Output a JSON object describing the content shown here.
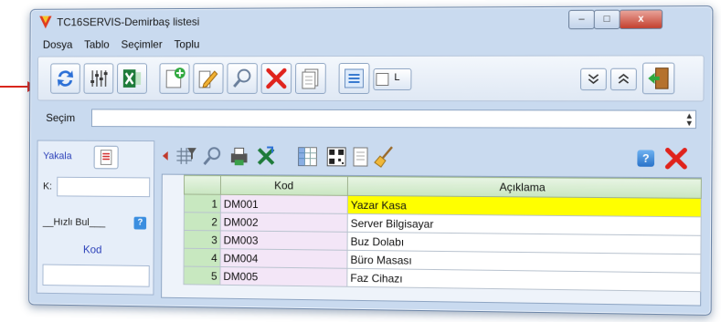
{
  "window": {
    "title": "TC16SERVIS-Demirbaş listesi",
    "controls": {
      "minimize": "–",
      "maximize": "□",
      "close": "x"
    }
  },
  "menu": [
    "Dosya",
    "Tablo",
    "Seçimler",
    "Toplu"
  ],
  "toolbar": {
    "buttons": [
      "refresh-icon",
      "equalizer-icon",
      "excel-icon",
      "add-doc-icon",
      "edit-icon",
      "search-icon",
      "delete-icon",
      "copy-icon",
      "zoom-icon",
      "small-icon",
      "scroll-down-icon",
      "scroll-up-icon",
      "exit-door-icon"
    ],
    "small_label": "L"
  },
  "secim": {
    "label": "Seçim",
    "value": ""
  },
  "left_panel": {
    "yakala_label": "Yakala",
    "k_label": "K:",
    "k_value": "",
    "hizli_label": "__Hızlı Bul___",
    "help_label": "?",
    "kod_label": "Kod",
    "kod_value": ""
  },
  "grid_toolbar": {
    "icons": [
      "filter-icon",
      "search-icon",
      "print-icon",
      "excel-icon",
      "spreadsheet-icon",
      "qr-icon",
      "doc-icon",
      "broom-icon",
      "help-icon",
      "close-icon"
    ],
    "help_label": "?"
  },
  "table": {
    "columns": [
      "Kod",
      "Açıklama"
    ],
    "rows": [
      {
        "no": "1",
        "kod": "DM001",
        "aciklama": "Yazar Kasa"
      },
      {
        "no": "2",
        "kod": "DM002",
        "aciklama": "Server Bilgisayar"
      },
      {
        "no": "3",
        "kod": "DM003",
        "aciklama": "Buz Dolabı"
      },
      {
        "no": "4",
        "kod": "DM004",
        "aciklama": "Büro Masası"
      },
      {
        "no": "5",
        "kod": "DM005",
        "aciklama": "Faz Cihazı"
      }
    ],
    "selected_row": 1
  },
  "colors": {
    "selected_row": "#ffff00",
    "row_number_bg": "#c8e8c0",
    "kod_bg": "#f3e6f7",
    "window_bg": "#c9daef",
    "arrow": "#d9261c"
  }
}
